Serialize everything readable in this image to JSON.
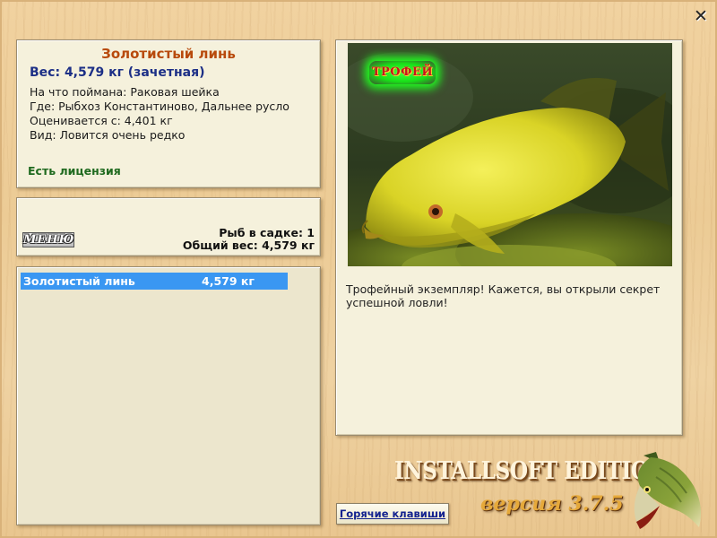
{
  "window": {
    "close_glyph": "✕"
  },
  "fish_info": {
    "title": "Золотистый линь",
    "weight": "Вес: 4,579 кг (зачетная)",
    "lines": [
      "На что поймана: Раковая шейка",
      "Где: Рыбхоз Константиново, Дальнее русло",
      "Оценивается с: 4,401 кг",
      "Вид: Ловится очень редко"
    ],
    "license": "Есть лицензия"
  },
  "cage": {
    "menu_label": "МЕНЮ",
    "fish_count": "Рыб в садке: 1",
    "total_weight": "Общий вес: 4,579 кг"
  },
  "catch_list": [
    {
      "name": "Золотистый линь",
      "weight": "4,579 кг",
      "selected": true
    }
  ],
  "photo": {
    "badge": "ТРОФЕЙ",
    "description": "Трофейный экземпляр! Кажется, вы открыли секрет успешной ловли!"
  },
  "branding": {
    "title": "INSTALLSOFT EDITION",
    "version": "версия 3.7.5",
    "logo_icon": "pike-fish-icon"
  },
  "footer": {
    "hotkeys_label": "Горячие клавиши"
  },
  "colors": {
    "title_orange": "#b84a0c",
    "weight_blue": "#1c2f86",
    "license_green": "#1f6a1f",
    "selection_blue": "#3a97f2",
    "trophy_green": "#20ff20"
  }
}
